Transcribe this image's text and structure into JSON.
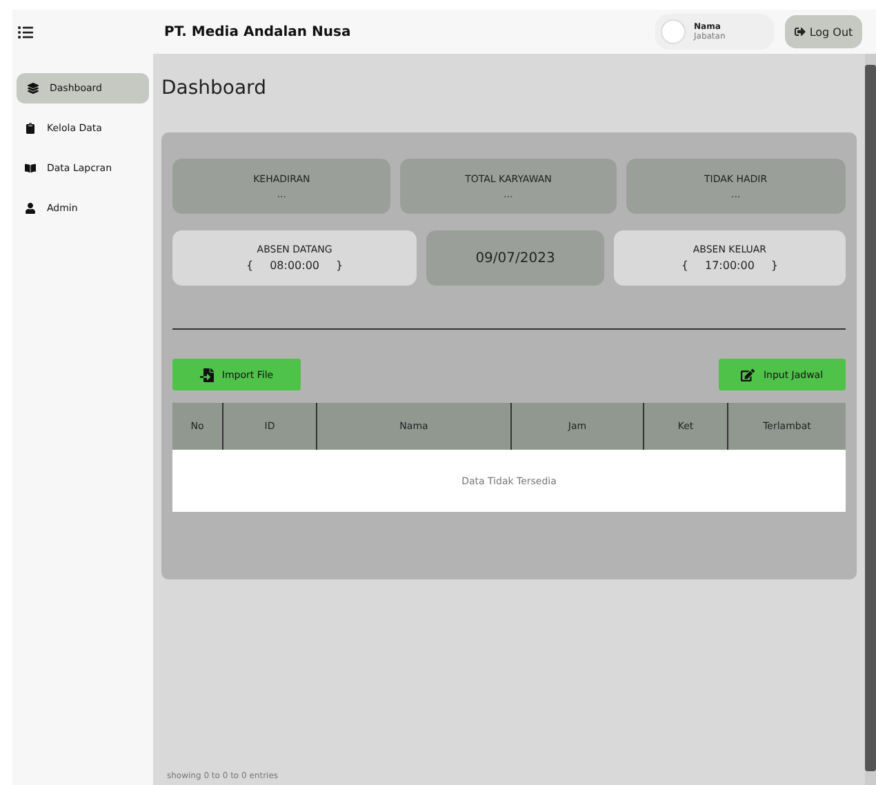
{
  "header": {
    "company": "PT. Media Andalan Nusa",
    "user": {
      "name": "Nama",
      "role": "Jabatan"
    },
    "logout": "Log Out"
  },
  "sidebar": {
    "items": [
      {
        "label": "Dashboard",
        "selected": true
      },
      {
        "label": "Kelola Data",
        "selected": false
      },
      {
        "label": "Data Lapcran",
        "selected": false
      },
      {
        "label": "Admin",
        "selected": false
      }
    ]
  },
  "page_title": "Dashboard",
  "stats": [
    {
      "label": "KEHADIRAN",
      "value": "..."
    },
    {
      "label": "TOTAL KARYAWAN",
      "value": "..."
    },
    {
      "label": "TIDAK HADIR",
      "value": "..."
    }
  ],
  "times": [
    {
      "kind": "time",
      "label": "ABSEN DATANG",
      "open": "{",
      "value": "08:00:00",
      "close": "}"
    },
    {
      "kind": "date",
      "value": "09/07/2023"
    },
    {
      "kind": "time",
      "label": "ABSEN KELUAR",
      "open": "{",
      "value": "17:00:00",
      "close": "}"
    }
  ],
  "buttons": [
    {
      "label": "Import File"
    },
    {
      "label": "Input Jadwal"
    }
  ],
  "table": {
    "columns": [
      "No",
      "ID",
      "Nama",
      "Jam",
      "Ket",
      "Terlambat"
    ],
    "empty": "Data Tidak Tersedia"
  },
  "footer": "showing 0 to 0  to 0 entries"
}
